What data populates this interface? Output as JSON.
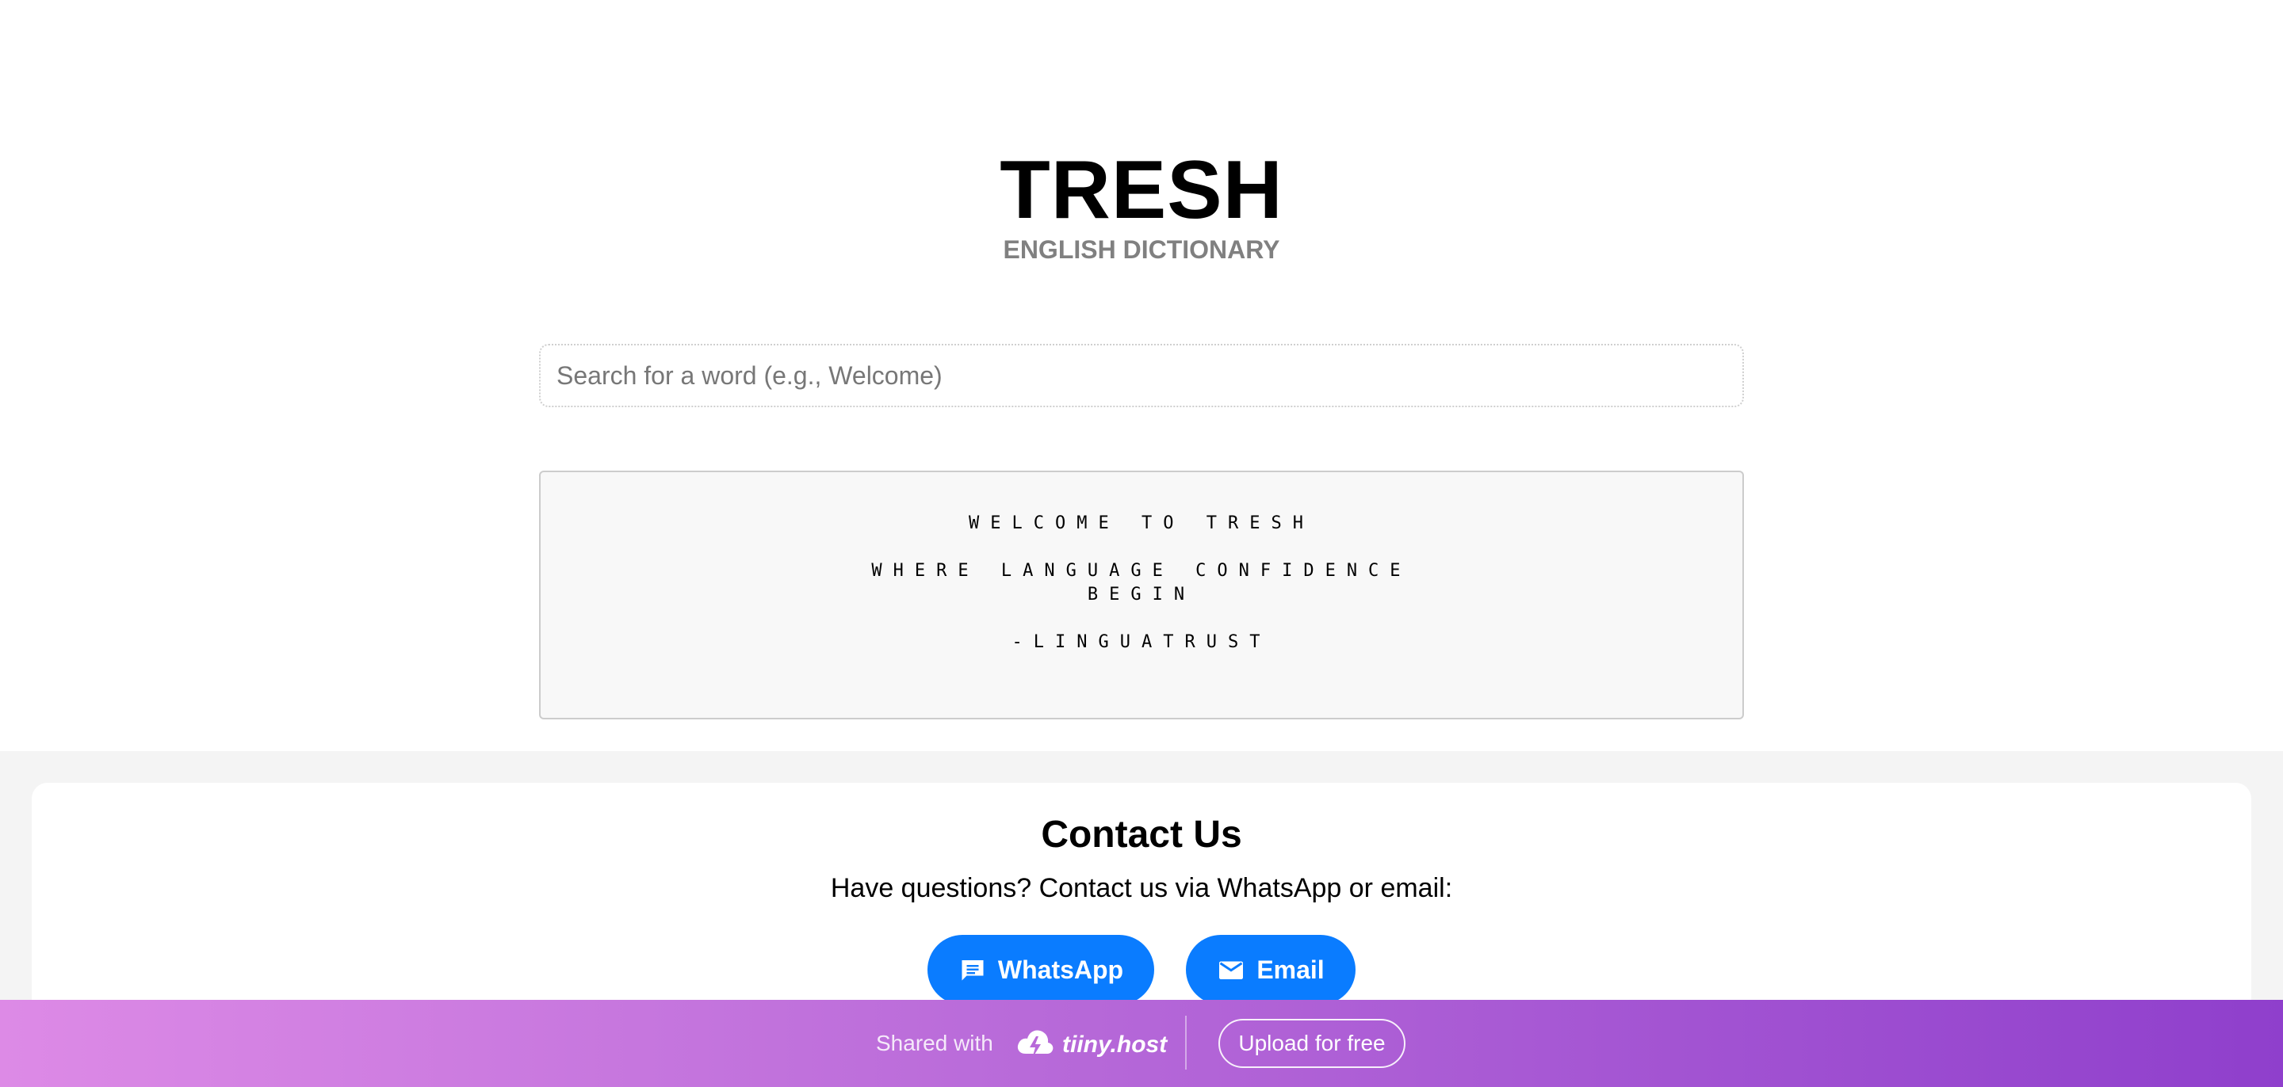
{
  "header": {
    "title": "TRESH",
    "subtitle": "ENGLISH DICTIONARY"
  },
  "search": {
    "placeholder": "Search for a word (e.g., Welcome)",
    "value": ""
  },
  "welcome": {
    "line1": "WELCOME TO TRESH",
    "line2": "WHERE LANGUAGE CONFIDENCE BEGIN",
    "line3": "-LINGUATRUST"
  },
  "contact": {
    "title": "Contact Us",
    "text": "Have questions? Contact us via WhatsApp or email:",
    "whatsapp_label": "WhatsApp",
    "email_label": "Email",
    "whatsapp_icon": "chat-icon",
    "email_icon": "mail-icon"
  },
  "banner": {
    "shared_text": "Shared with",
    "logo_text": "tiiny.host",
    "upload_label": "Upload for free"
  },
  "colors": {
    "button_blue": "#0a7cff",
    "banner_start": "#dd8ae6",
    "banner_end": "#8f3fcc",
    "subtitle_gray": "#808080"
  }
}
